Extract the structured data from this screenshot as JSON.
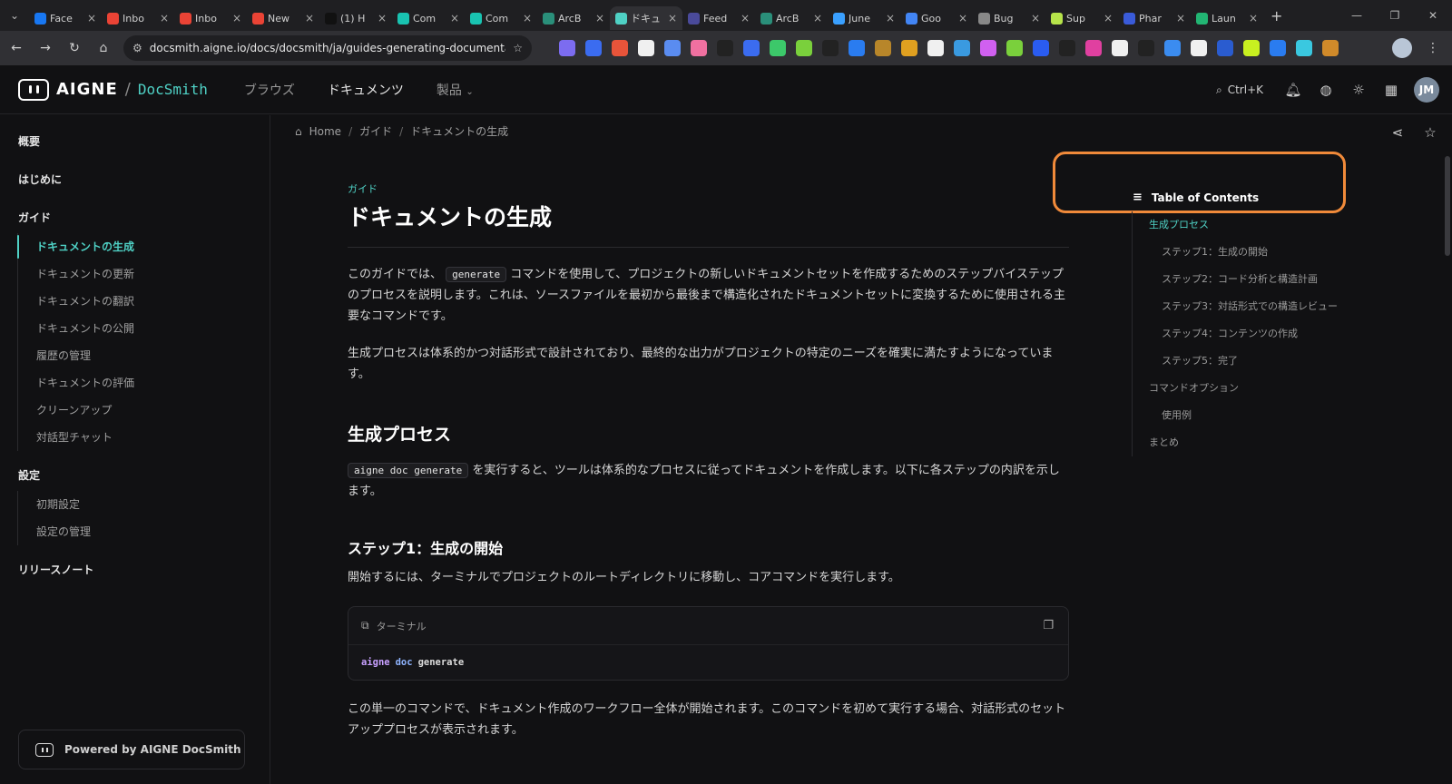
{
  "browser": {
    "tabs": [
      {
        "label": "Face",
        "color": "#1877f2"
      },
      {
        "label": "Inbo",
        "color": "#ea4335"
      },
      {
        "label": "Inbo",
        "color": "#ea4335"
      },
      {
        "label": "New",
        "color": "#ea4335"
      },
      {
        "label": "(1) H",
        "color": "#111111"
      },
      {
        "label": "Com",
        "color": "#19c3b1"
      },
      {
        "label": "Com",
        "color": "#19c3b1"
      },
      {
        "label": "ArcB",
        "color": "#2a8f7a"
      },
      {
        "label": "ドキュ",
        "color": "#4fd1c5",
        "active": true
      },
      {
        "label": "Feed",
        "color": "#4a4a9a"
      },
      {
        "label": "ArcB",
        "color": "#2a8f7a"
      },
      {
        "label": "June",
        "color": "#3aa0ff"
      },
      {
        "label": "Goo",
        "color": "#4285f4"
      },
      {
        "label": "Bug",
        "color": "#888888"
      },
      {
        "label": "Sup",
        "color": "#b6e34a"
      },
      {
        "label": "Phar",
        "color": "#3a5bd9"
      },
      {
        "label": "Laun",
        "color": "#22b573"
      }
    ],
    "url": "docsmith.aigne.io/docs/docsmith/ja/guides-generating-documentation-2...",
    "extension_colors": [
      "#7c6cf0",
      "#3b6cf0",
      "#e8543a",
      "#f0f0f0",
      "#5a8cf0",
      "#f070a0",
      "#222222",
      "#3b6cf0",
      "#3cc86a",
      "#7ad03c",
      "#222222",
      "#2a7cf0",
      "#b8862a",
      "#e0a020",
      "#f0f0f0",
      "#3a9ae0",
      "#d060f0",
      "#7ad03c",
      "#2a5cf0",
      "#222222",
      "#e040a0",
      "#f0f0f0",
      "#222222",
      "#3b8cf0",
      "#f0f0f0",
      "#2a5cd0",
      "#c8f020",
      "#2a7cf0",
      "#3ac8e0",
      "#d08a2a"
    ]
  },
  "header": {
    "brand": "AIGNE",
    "brand_sep": "/",
    "brand_sub": "DocSmith",
    "nav": [
      {
        "label": "ブラウズ",
        "active": false
      },
      {
        "label": "ドキュメンツ",
        "active": true
      },
      {
        "label": "製品",
        "active": false
      }
    ],
    "search_label": "Ctrl+K",
    "avatar_initials": "JM"
  },
  "sidebar": {
    "overview": "概要",
    "getting_started": "はじめに",
    "guides": "ガイド",
    "guide_items": [
      "ドキュメントの生成",
      "ドキュメントの更新",
      "ドキュメントの翻訳",
      "ドキュメントの公開",
      "履歴の管理",
      "ドキュメントの評価",
      "クリーンアップ",
      "対話型チャット"
    ],
    "settings": "設定",
    "settings_items": [
      "初期設定",
      "設定の管理"
    ],
    "release_notes": "リリースノート",
    "powered_by": "Powered by AIGNE DocSmith"
  },
  "breadcrumb": {
    "home": "Home",
    "sep": "/",
    "guide": "ガイド",
    "current": "ドキュメントの生成"
  },
  "article": {
    "eyebrow": "ガイド",
    "title": "ドキュメントの生成",
    "intro_pre": "このガイドでは、",
    "intro_code": "generate",
    "intro_post": "コマンドを使用して、プロジェクトの新しいドキュメントセットを作成するためのステップバイステップのプロセスを説明します。これは、ソースファイルを最初から最後まで構造化されたドキュメントセットに変換するために使用される主要なコマンドです。",
    "para2": "生成プロセスは体系的かつ対話形式で設計されており、最終的な出力がプロジェクトの特定のニーズを確実に満たすようになっています。",
    "h2": "生成プロセス",
    "h2_code": "aigne doc generate",
    "h2_para": "を実行すると、ツールは体系的なプロセスに従ってドキュメントを作成します。以下に各ステップの内訳を示します。",
    "h3": "ステップ1：生成の開始",
    "h3_para": "開始するには、ターミナルでプロジェクトのルートディレクトリに移動し、コアコマンドを実行します。",
    "code_title": "ターミナル",
    "code_tokens": [
      "aigne",
      "doc",
      "generate"
    ],
    "after_code": "この単一のコマンドで、ドキュメント作成のワークフロー全体が開始されます。このコマンドを初めて実行する場合、対話形式のセットアッププロセスが表示されます。"
  },
  "toc": {
    "title": "Table of Contents",
    "items": [
      {
        "label": "生成プロセス",
        "level": 1,
        "active": true
      },
      {
        "label": "ステップ1：生成の開始",
        "level": 2
      },
      {
        "label": "ステップ2：コード分析と構造計画",
        "level": 2
      },
      {
        "label": "ステップ3：対話形式での構造レビュー",
        "level": 2
      },
      {
        "label": "ステップ4：コンテンツの作成",
        "level": 2
      },
      {
        "label": "ステップ5：完了",
        "level": 2
      },
      {
        "label": "コマンドオプション",
        "level": 1
      },
      {
        "label": "使用例",
        "level": 2
      },
      {
        "label": "まとめ",
        "level": 1
      }
    ]
  },
  "colors": {
    "accent": "#4fd1c5",
    "highlight": "#f08a3a",
    "background": "#111113"
  }
}
